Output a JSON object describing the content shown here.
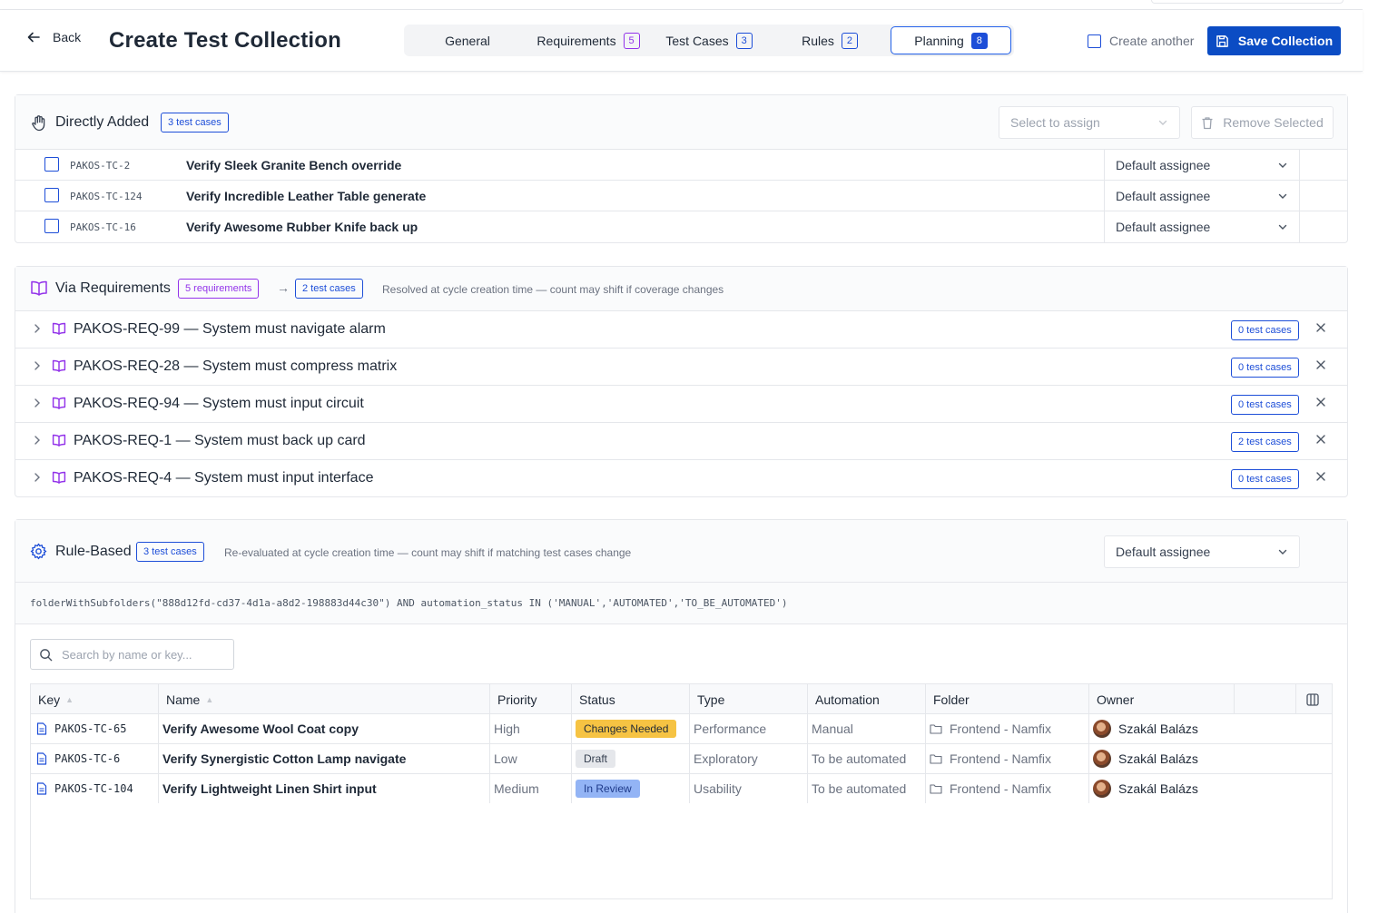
{
  "header": {
    "back_label": "Back",
    "title": "Create Test Collection",
    "tabs": [
      {
        "label": "General",
        "count": ""
      },
      {
        "label": "Requirements",
        "count": "5"
      },
      {
        "label": "Test Cases",
        "count": "3"
      },
      {
        "label": "Rules",
        "count": "2"
      },
      {
        "label": "Planning",
        "count": "8"
      }
    ],
    "create_another_label": "Create another",
    "save_label": "Save Collection"
  },
  "directly_added": {
    "title": "Directly Added",
    "badge": "3 test cases",
    "select_placeholder": "Select to assign",
    "remove_label": "Remove Selected",
    "rows": [
      {
        "key": "PAKOS-TC-2",
        "name": "Verify Sleek Granite Bench override",
        "assignee": "Default assignee"
      },
      {
        "key": "PAKOS-TC-124",
        "name": "Verify Incredible Leather Table generate",
        "assignee": "Default assignee"
      },
      {
        "key": "PAKOS-TC-16",
        "name": "Verify Awesome Rubber Knife back up",
        "assignee": "Default assignee"
      }
    ]
  },
  "via_requirements": {
    "title": "Via Requirements",
    "req_badge": "5 requirements",
    "arrow": "→",
    "tc_badge": "2 test cases",
    "hint": "Resolved at cycle creation time — count may shift if coverage changes",
    "rows": [
      {
        "label": "PAKOS-REQ-99 — System must navigate alarm",
        "badge": "0 test cases"
      },
      {
        "label": "PAKOS-REQ-28 — System must compress matrix",
        "badge": "0 test cases"
      },
      {
        "label": "PAKOS-REQ-94 — System must input circuit",
        "badge": "0 test cases"
      },
      {
        "label": "PAKOS-REQ-1 — System must back up card",
        "badge": "2 test cases"
      },
      {
        "label": "PAKOS-REQ-4 — System must input interface",
        "badge": "0 test cases"
      }
    ]
  },
  "rule_based": {
    "title": "Rule-Based",
    "badge": "3 test cases",
    "hint": "Re-evaluated at cycle creation time — count may shift if matching test cases change",
    "assignee": "Default assignee",
    "query": "folderWithSubfolders(\"888d12fd-cd37-4d1a-a8d2-198883d44c30\") AND automation_status IN ('MANUAL','AUTOMATED','TO_BE_AUTOMATED')",
    "search_placeholder": "Search by name or key...",
    "columns": [
      "Key",
      "Name",
      "Priority",
      "Status",
      "Type",
      "Automation",
      "Folder",
      "Owner"
    ],
    "rows": [
      {
        "key": "PAKOS-TC-65",
        "name": "Verify Awesome Wool Coat copy",
        "priority": "High",
        "status": "Changes Needed",
        "status_color": "#f6c343",
        "type": "Performance",
        "automation": "Manual",
        "folder": "Frontend - Namfix",
        "owner": "Szakál Balázs"
      },
      {
        "key": "PAKOS-TC-6",
        "name": "Verify Synergistic Cotton Lamp navigate",
        "priority": "Low",
        "status": "Draft",
        "status_color": "#e5e7eb",
        "type": "Exploratory",
        "automation": "To be automated",
        "folder": "Frontend - Namfix",
        "owner": "Szakál Balázs"
      },
      {
        "key": "PAKOS-TC-104",
        "name": "Verify Lightweight Linen Shirt input",
        "priority": "Medium",
        "status": "In Review",
        "status_color": "#93b4f5",
        "type": "Usability",
        "automation": "To be automated",
        "folder": "Frontend - Namfix",
        "owner": "Szakál Balázs"
      }
    ]
  },
  "colors": {
    "accent": "#0b4cc4",
    "purple": "#9333ea",
    "border": "#e5e7eb"
  }
}
